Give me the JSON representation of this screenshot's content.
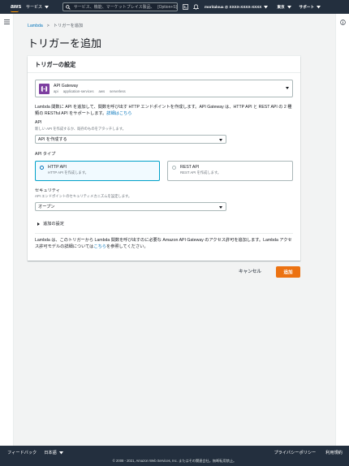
{
  "topbar": {
    "logo": "aws",
    "services_label": "サービス",
    "search_placeholder": "サービス、機能、マーケットプレイス製品、ドキュメントを検索",
    "search_shortcut": "[Option+S]",
    "account": "moritaloua @ XXXX-XXXX-XXXX",
    "region": "東京",
    "support": "サポート"
  },
  "breadcrumb": {
    "parent": "Lambda",
    "separator": ">",
    "current": "トリガーを追加"
  },
  "page_title": "トリガーを追加",
  "panel": {
    "title": "トリガーの設定",
    "trigger": {
      "name": "API Gateway",
      "tags": [
        "api",
        "application-services",
        "aws",
        "serverless"
      ]
    },
    "description": "Lambda 関数に API を追加して、関数を呼び出す HTTP エンドポイントを作成します。API Gateway は、HTTP API と REST API の 2 種類の RESTful API をサポートします。",
    "description_link": "詳細はこちら",
    "api": {
      "label": "API",
      "sub": "新しい API を作成するか、既存のものをアタッチします。",
      "value": "API を作成する"
    },
    "api_type": {
      "label": "API タイプ",
      "options": [
        {
          "title": "HTTP API",
          "desc": "HTTP API を作成します。",
          "selected": true
        },
        {
          "title": "REST API",
          "desc": "REST API を作成します。",
          "selected": false
        }
      ]
    },
    "security": {
      "label": "セキュリティ",
      "sub": "API エンドポイントのセキュリティメカニズムを設定します。",
      "value": "オープン"
    },
    "additional": "追加の設定",
    "permission_text": "Lambda は、このトリガーから Lambda 関数を呼び出すのに必要な Amazon API Gateway のアクセス許可を追加します。Lambda アクセス許可モデルの詳細については",
    "permission_link": "こちら",
    "permission_tail": "を参照してください。"
  },
  "actions": {
    "cancel": "キャンセル",
    "add": "追加"
  },
  "footer": {
    "feedback": "フィードバック",
    "language": "日本語",
    "privacy": "プライバシーポリシー",
    "terms": "利用規約",
    "copyright": "© 2008 - 2021, Amazon Web Services, Inc. またはその関連会社。無断転用禁止。"
  },
  "colors": {
    "nav": "#232f3e",
    "accent": "#ec7211",
    "link": "#0073bb",
    "lambda_purple": "#7d3ea0"
  }
}
